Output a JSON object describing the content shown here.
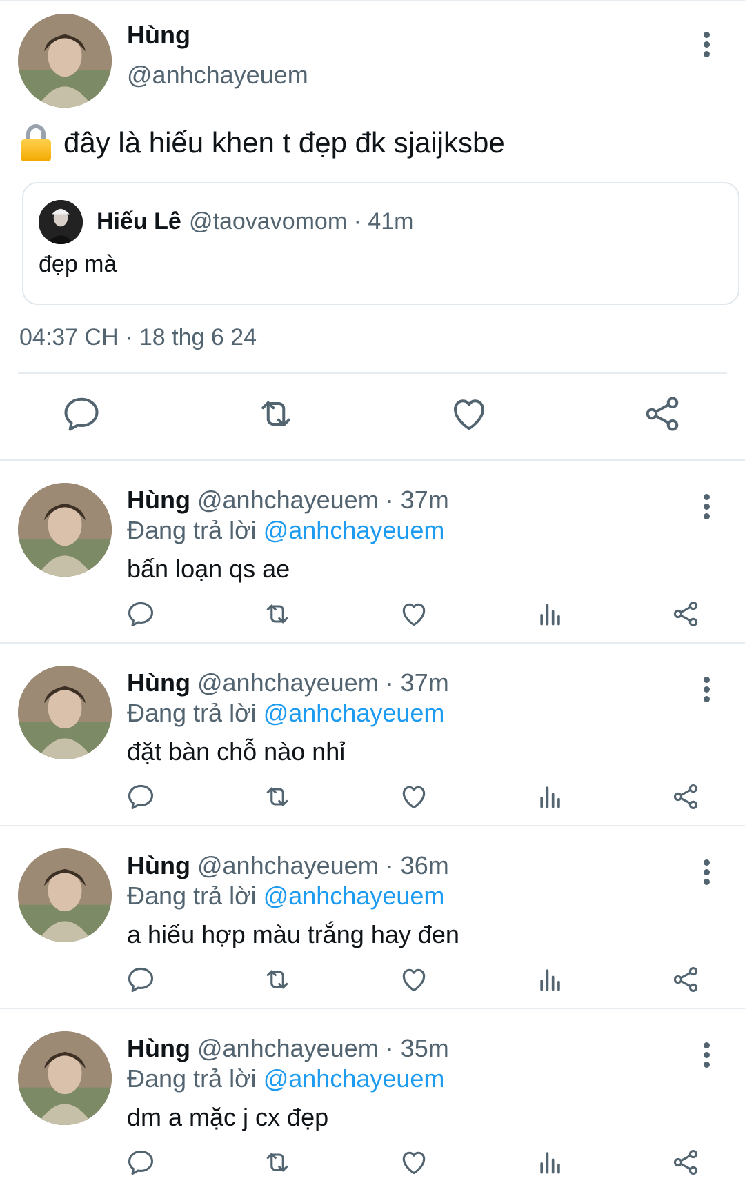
{
  "colors": {
    "accent": "#1d9bf0",
    "secondary_text": "#536471",
    "divider": "#e6ecf0"
  },
  "main_tweet": {
    "author_name": "Hùng",
    "author_handle": "@anhchayeuem",
    "lock_icon": "lock-icon",
    "text": "đây là hiếu khen t đẹp đk sjaijksbe",
    "quoted": {
      "name": "Hiếu Lê",
      "meta": "@taovavomom · 41m",
      "text": "đẹp mà"
    },
    "timestamp": "04:37 CH · 18 thg 6 24",
    "actions": [
      "reply-icon",
      "retweet-icon",
      "like-icon",
      "share-icon"
    ]
  },
  "replies": [
    {
      "name": "Hùng",
      "meta": "@anhchayeuem · 37m",
      "replying_label": "Đang trả lời",
      "replying_to": "@anhchayeuem",
      "text": "bấn loạn qs ae"
    },
    {
      "name": "Hùng",
      "meta": "@anhchayeuem · 37m",
      "replying_label": "Đang trả lời",
      "replying_to": "@anhchayeuem",
      "text": "đặt bàn chỗ nào nhỉ"
    },
    {
      "name": "Hùng",
      "meta": "@anhchayeuem · 36m",
      "replying_label": "Đang trả lời",
      "replying_to": "@anhchayeuem",
      "text": "a hiếu hợp màu trắng hay đen"
    },
    {
      "name": "Hùng",
      "meta": "@anhchayeuem · 35m",
      "replying_label": "Đang trả lời",
      "replying_to": "@anhchayeuem",
      "text": "dm a mặc j cx đẹp"
    }
  ]
}
